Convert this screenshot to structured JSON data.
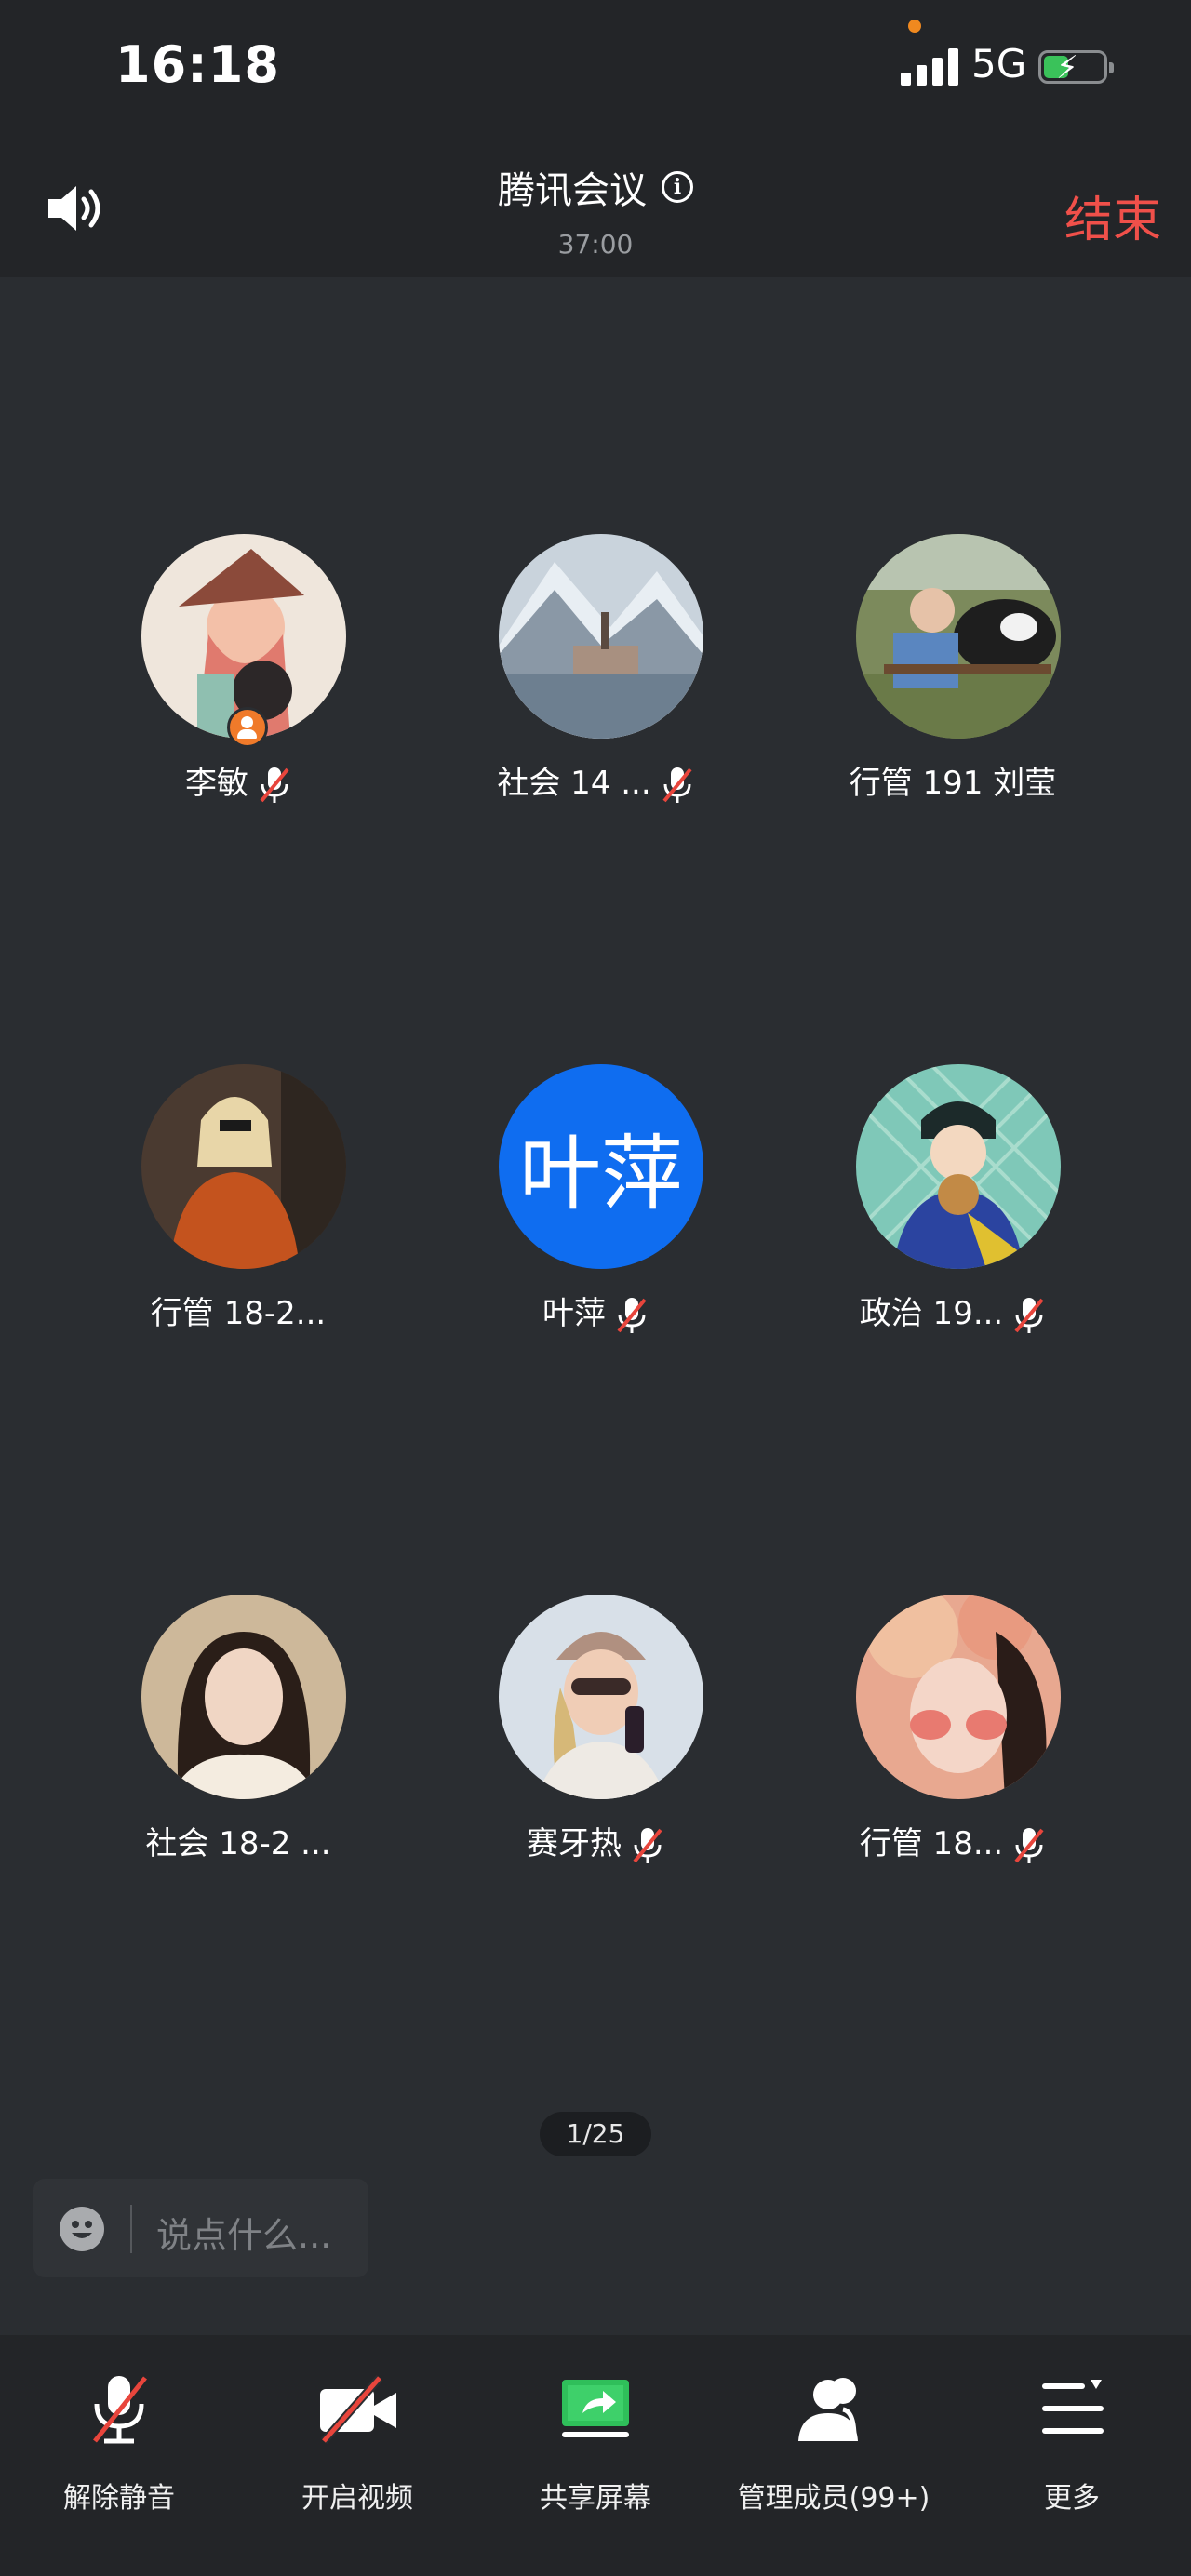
{
  "status_bar": {
    "time": "16:18",
    "network": "5G"
  },
  "header": {
    "speaker_icon": "speaker-icon",
    "title": "腾讯会议",
    "duration": "37:00",
    "end_label": "结束"
  },
  "participants": [
    {
      "name": "李敏",
      "muted": true,
      "host": true,
      "avatar": "photo"
    },
    {
      "name": "社会 14 ...",
      "muted": true,
      "avatar": "photo"
    },
    {
      "name": "行管 191 刘莹",
      "muted": false,
      "avatar": "photo"
    },
    {
      "name": "行管 18-2...",
      "muted": false,
      "avatar": "photo"
    },
    {
      "name": "叶萍",
      "muted": true,
      "avatar": "text",
      "avatar_text": "叶萍",
      "avatar_color": "#0f6df0"
    },
    {
      "name": "政治 19...",
      "muted": true,
      "avatar": "photo"
    },
    {
      "name": "社会 18-2 ...",
      "muted": false,
      "avatar": "photo"
    },
    {
      "name": "赛牙热",
      "muted": true,
      "avatar": "photo"
    },
    {
      "name": "行管 18...",
      "muted": true,
      "avatar": "photo"
    }
  ],
  "pager": "1/25",
  "chat": {
    "placeholder": "说点什么..."
  },
  "toolbar": [
    {
      "label": "解除静音",
      "icon": "mic-muted-icon"
    },
    {
      "label": "开启视频",
      "icon": "camera-off-icon"
    },
    {
      "label": "共享屏幕",
      "icon": "share-screen-icon"
    },
    {
      "label": "管理成员(99+)",
      "icon": "members-icon"
    },
    {
      "label": "更多",
      "icon": "more-icon"
    }
  ],
  "colors": {
    "accent_red": "#f0504a",
    "avatar_blue": "#0f6df0",
    "share_green": "#2fbf5a",
    "host_orange": "#f07a2a"
  }
}
